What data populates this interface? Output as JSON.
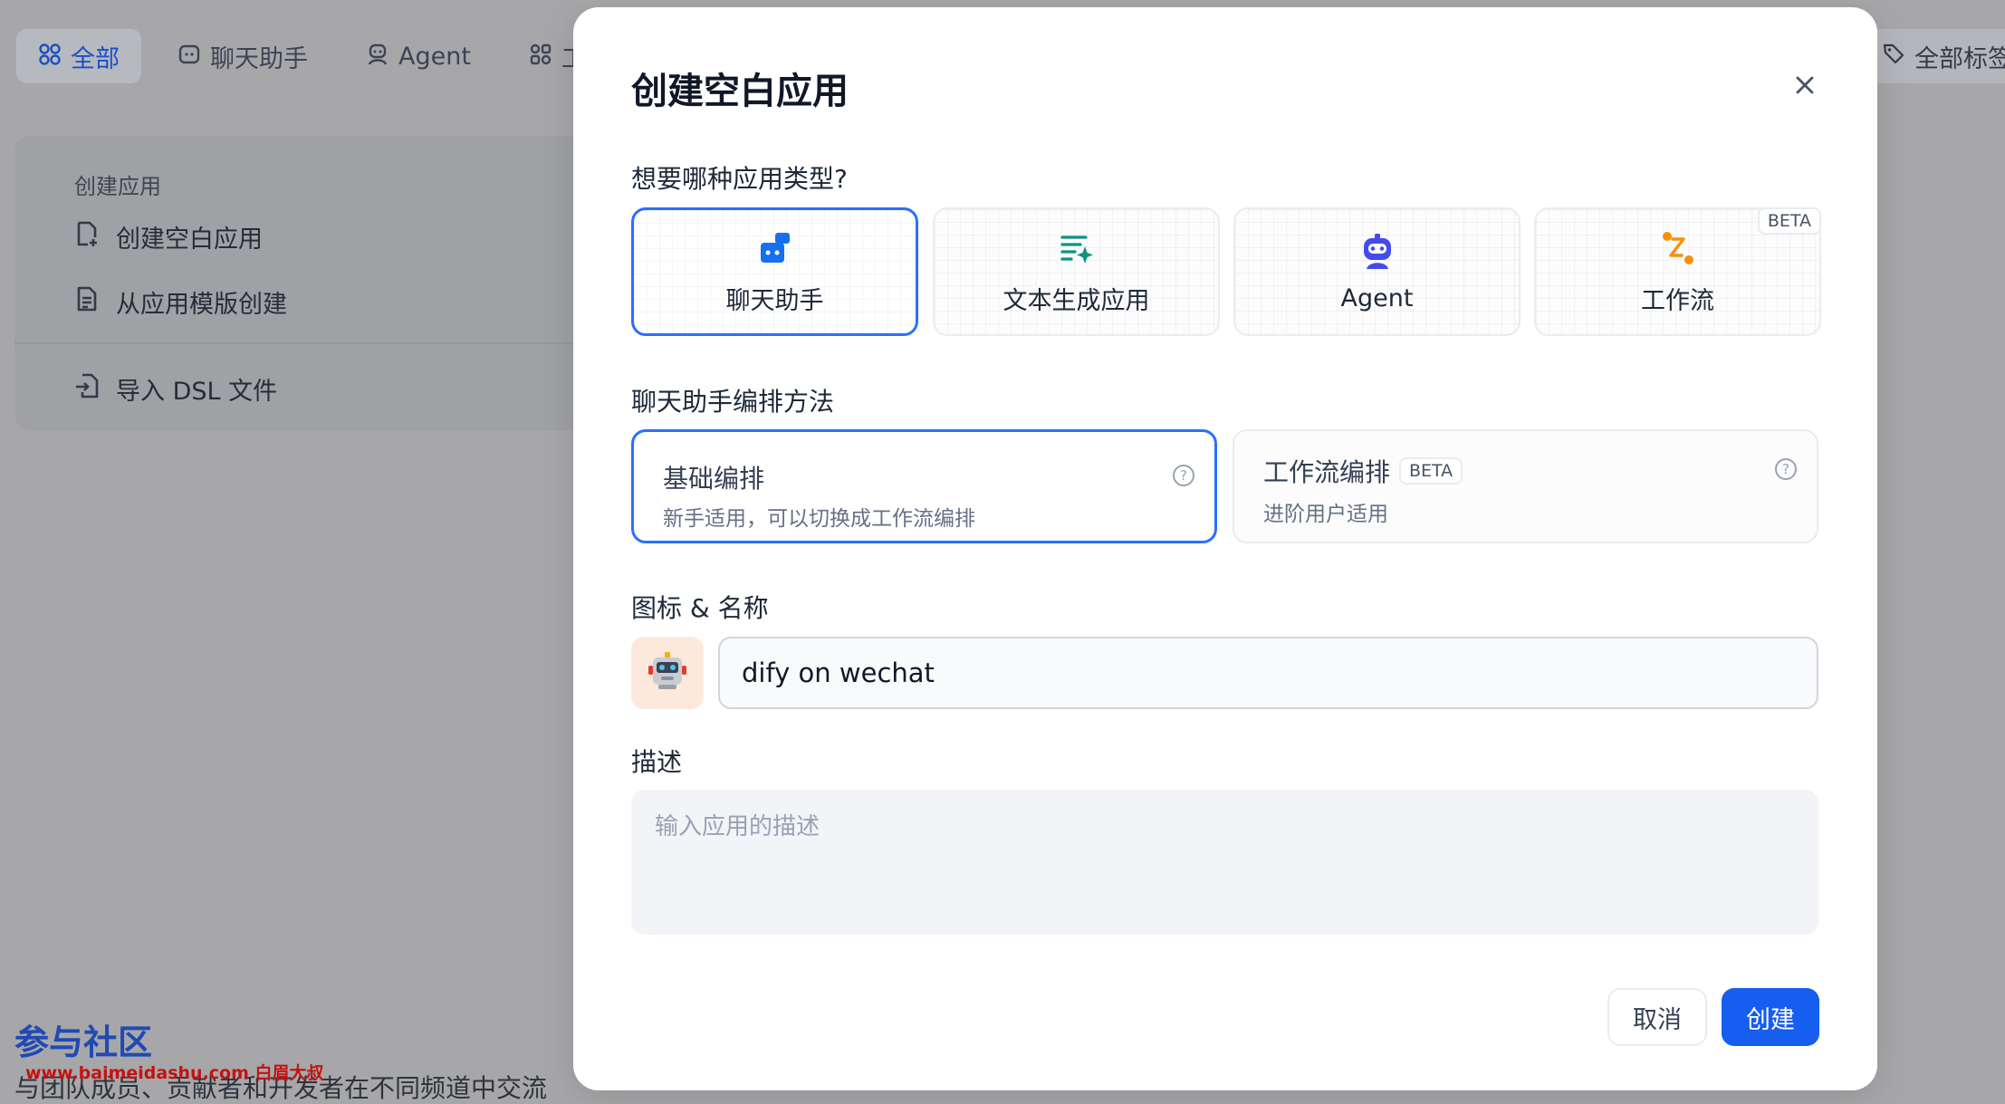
{
  "background": {
    "tabs": [
      {
        "label": "全部",
        "icon": "grid-icon",
        "active": true
      },
      {
        "label": "聊天助手",
        "icon": "chat-bubble-icon",
        "active": false
      },
      {
        "label": "Agent",
        "icon": "agent-icon",
        "active": false
      },
      {
        "label": "工作",
        "icon": "workflow-icon",
        "active": false
      }
    ],
    "tag_filter_label": "全部标签",
    "create_section": {
      "title": "创建应用",
      "create_blank": "创建空白应用",
      "from_template": "从应用模版创建",
      "import_dsl": "导入 DSL 文件"
    },
    "community": {
      "title": "参与社区",
      "watermark": "www.baimeidashu.com 白眉大叔",
      "description": "与团队成员、贡献者和开发者在不同频道中交流"
    }
  },
  "modal": {
    "title": "创建空白应用",
    "close_icon": "close-icon",
    "type_question": "想要哪种应用类型?",
    "app_types": [
      {
        "label": "聊天助手",
        "icon": "chat-assistant-icon",
        "color": "#1570ef",
        "selected": true
      },
      {
        "label": "文本生成应用",
        "icon": "text-generation-icon",
        "color": "#0e9384",
        "selected": false
      },
      {
        "label": "Agent",
        "icon": "agent-robot-icon",
        "color": "#444ce7",
        "selected": false
      },
      {
        "label": "工作流",
        "icon": "workflow-icon",
        "color": "#f79009",
        "selected": false,
        "badge": "BETA"
      }
    ],
    "method_label": "聊天助手编排方法",
    "methods": [
      {
        "title": "基础编排",
        "desc": "新手适用，可以切换成工作流编排",
        "selected": true
      },
      {
        "title": "工作流编排",
        "badge": "BETA",
        "desc": "进阶用户适用",
        "selected": false
      }
    ],
    "icon_name_label": "图标 & 名称",
    "app_icon": "robot-emoji-icon",
    "app_name_value": "dify on wechat",
    "description_label": "描述",
    "description_placeholder": "输入应用的描述",
    "cancel_label": "取消",
    "create_label": "创建"
  }
}
